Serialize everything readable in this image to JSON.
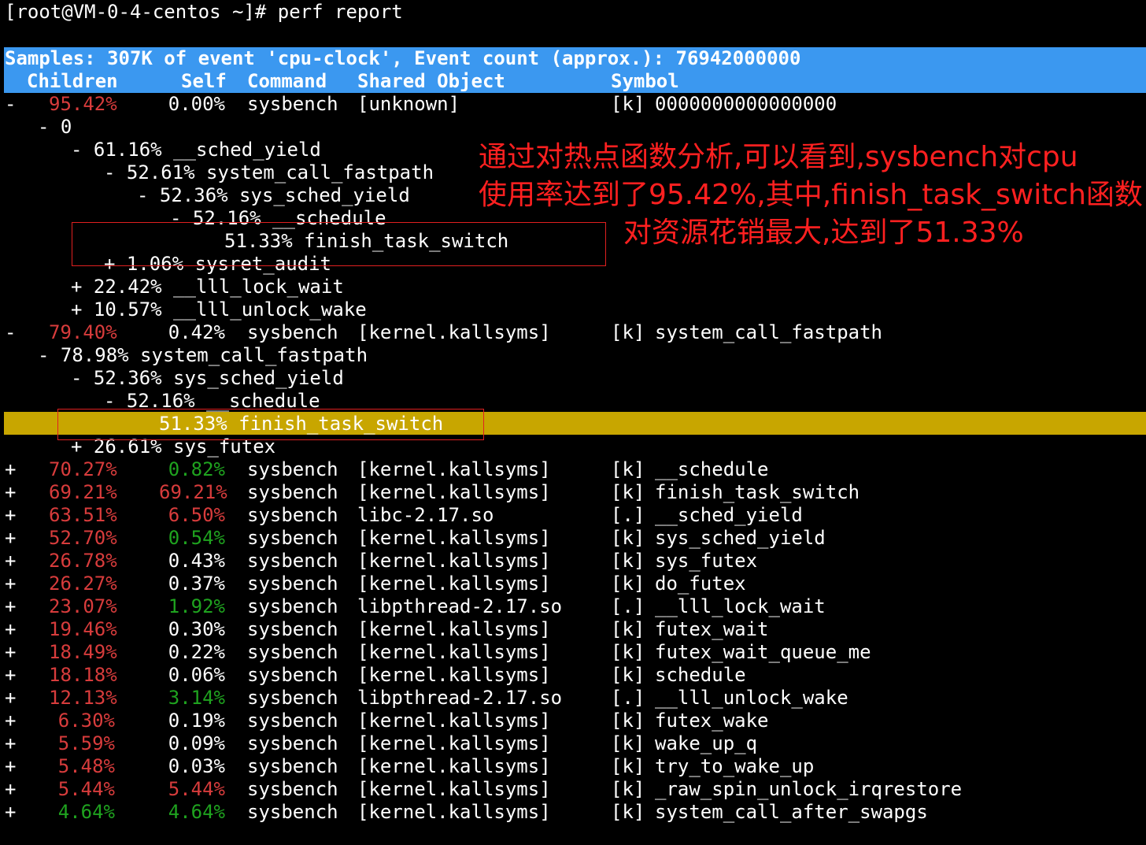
{
  "prompt": "[root@VM-0-4-centos ~]# perf report",
  "header": {
    "samples_line": "Samples: 307K of event 'cpu-clock', Event count (approx.): 76942000000",
    "columns": {
      "children": "Children",
      "self": "Self",
      "command": "Command",
      "shared_object": "Shared Object",
      "symbol": "Symbol"
    }
  },
  "tree": [
    {
      "text": "- 0"
    },
    {
      "text": "- 61.16% __sched_yield"
    },
    {
      "text": "- 52.61% system_call_fastpath"
    },
    {
      "text": "- 52.36% sys_sched_yield"
    },
    {
      "text": "- 52.16% __schedule"
    },
    {
      "text": "51.33% finish_task_switch"
    },
    {
      "text": "+ 1.06% sysret_audit"
    },
    {
      "text": "+ 22.42% __lll_lock_wait"
    },
    {
      "text": "+ 10.57% __lll_unlock_wake"
    },
    {
      "text": "- 78.98% system_call_fastpath"
    },
    {
      "text": "- 52.36% sys_sched_yield"
    },
    {
      "text": "- 52.16% __schedule"
    },
    {
      "text": "51.33% finish_task_switch"
    },
    {
      "text": "+ 26.61% sys_futex"
    }
  ],
  "rows": [
    {
      "marker": "-",
      "children": "95.42%",
      "self": "0.00%",
      "command": "sysbench",
      "shared_object": "[unknown]",
      "type": "[k]",
      "symbol": "0000000000000000",
      "children_color": "#d83c3c",
      "self_color": "#ffffff"
    },
    {
      "marker": "-",
      "children": "79.40%",
      "self": "0.42%",
      "command": "sysbench",
      "shared_object": "[kernel.kallsyms]",
      "type": "[k]",
      "symbol": "system_call_fastpath",
      "children_color": "#d83c3c",
      "self_color": "#ffffff"
    },
    {
      "marker": "+",
      "children": "70.27%",
      "self": "0.82%",
      "command": "sysbench",
      "shared_object": "[kernel.kallsyms]",
      "type": "[k]",
      "symbol": "__schedule",
      "children_color": "#d83c3c",
      "self_color": "#1fa31f"
    },
    {
      "marker": "+",
      "children": "69.21%",
      "self": "69.21%",
      "command": "sysbench",
      "shared_object": "[kernel.kallsyms]",
      "type": "[k]",
      "symbol": "finish_task_switch",
      "children_color": "#d83c3c",
      "self_color": "#d83c3c"
    },
    {
      "marker": "+",
      "children": "63.51%",
      "self": "6.50%",
      "command": "sysbench",
      "shared_object": "libc-2.17.so",
      "type": "[.]",
      "symbol": "__sched_yield",
      "children_color": "#d83c3c",
      "self_color": "#d83c3c"
    },
    {
      "marker": "+",
      "children": "52.70%",
      "self": "0.54%",
      "command": "sysbench",
      "shared_object": "[kernel.kallsyms]",
      "type": "[k]",
      "symbol": "sys_sched_yield",
      "children_color": "#d83c3c",
      "self_color": "#1fa31f"
    },
    {
      "marker": "+",
      "children": "26.78%",
      "self": "0.43%",
      "command": "sysbench",
      "shared_object": "[kernel.kallsyms]",
      "type": "[k]",
      "symbol": "sys_futex",
      "children_color": "#d83c3c",
      "self_color": "#ffffff"
    },
    {
      "marker": "+",
      "children": "26.27%",
      "self": "0.37%",
      "command": "sysbench",
      "shared_object": "[kernel.kallsyms]",
      "type": "[k]",
      "symbol": "do_futex",
      "children_color": "#d83c3c",
      "self_color": "#ffffff"
    },
    {
      "marker": "+",
      "children": "23.07%",
      "self": "1.92%",
      "command": "sysbench",
      "shared_object": "libpthread-2.17.so",
      "type": "[.]",
      "symbol": "__lll_lock_wait",
      "children_color": "#d83c3c",
      "self_color": "#1fa31f"
    },
    {
      "marker": "+",
      "children": "19.46%",
      "self": "0.30%",
      "command": "sysbench",
      "shared_object": "[kernel.kallsyms]",
      "type": "[k]",
      "symbol": "futex_wait",
      "children_color": "#d83c3c",
      "self_color": "#ffffff"
    },
    {
      "marker": "+",
      "children": "18.49%",
      "self": "0.22%",
      "command": "sysbench",
      "shared_object": "[kernel.kallsyms]",
      "type": "[k]",
      "symbol": "futex_wait_queue_me",
      "children_color": "#d83c3c",
      "self_color": "#ffffff"
    },
    {
      "marker": "+",
      "children": "18.18%",
      "self": "0.06%",
      "command": "sysbench",
      "shared_object": "[kernel.kallsyms]",
      "type": "[k]",
      "symbol": "schedule",
      "children_color": "#d83c3c",
      "self_color": "#ffffff"
    },
    {
      "marker": "+",
      "children": "12.13%",
      "self": "3.14%",
      "command": "sysbench",
      "shared_object": "libpthread-2.17.so",
      "type": "[.]",
      "symbol": "__lll_unlock_wake",
      "children_color": "#d83c3c",
      "self_color": "#1fa31f"
    },
    {
      "marker": "+",
      "children": "6.30%",
      "self": "0.19%",
      "command": "sysbench",
      "shared_object": "[kernel.kallsyms]",
      "type": "[k]",
      "symbol": "futex_wake",
      "children_color": "#d83c3c",
      "self_color": "#ffffff"
    },
    {
      "marker": "+",
      "children": "5.59%",
      "self": "0.09%",
      "command": "sysbench",
      "shared_object": "[kernel.kallsyms]",
      "type": "[k]",
      "symbol": "wake_up_q",
      "children_color": "#d83c3c",
      "self_color": "#ffffff"
    },
    {
      "marker": "+",
      "children": "5.48%",
      "self": "0.03%",
      "command": "sysbench",
      "shared_object": "[kernel.kallsyms]",
      "type": "[k]",
      "symbol": "try_to_wake_up",
      "children_color": "#d83c3c",
      "self_color": "#ffffff"
    },
    {
      "marker": "+",
      "children": "5.44%",
      "self": "5.44%",
      "command": "sysbench",
      "shared_object": "[kernel.kallsyms]",
      "type": "[k]",
      "symbol": "_raw_spin_unlock_irqrestore",
      "children_color": "#d83c3c",
      "self_color": "#d83c3c"
    },
    {
      "marker": "+",
      "children": "4.64%",
      "self": "4.64%",
      "command": "sysbench",
      "shared_object": "[kernel.kallsyms]",
      "type": "[k]",
      "symbol": "system_call_after_swapgs",
      "children_color": "#1fa31f",
      "self_color": "#1fa31f"
    }
  ],
  "annotation": {
    "lines": [
      "通过对热点函数分析,可以看到,sysbench对cpu",
      "使用率达到了95.42%,其中,finish_task_switch函数",
      "对资源花销最大,达到了51.33%"
    ]
  },
  "colors": {
    "header_bg": "#3b98f0",
    "selected_row_bg": "#c8a600",
    "high_percent": "#d83c3c",
    "low_percent": "#1fa31f",
    "annotation": "#ff2020"
  }
}
